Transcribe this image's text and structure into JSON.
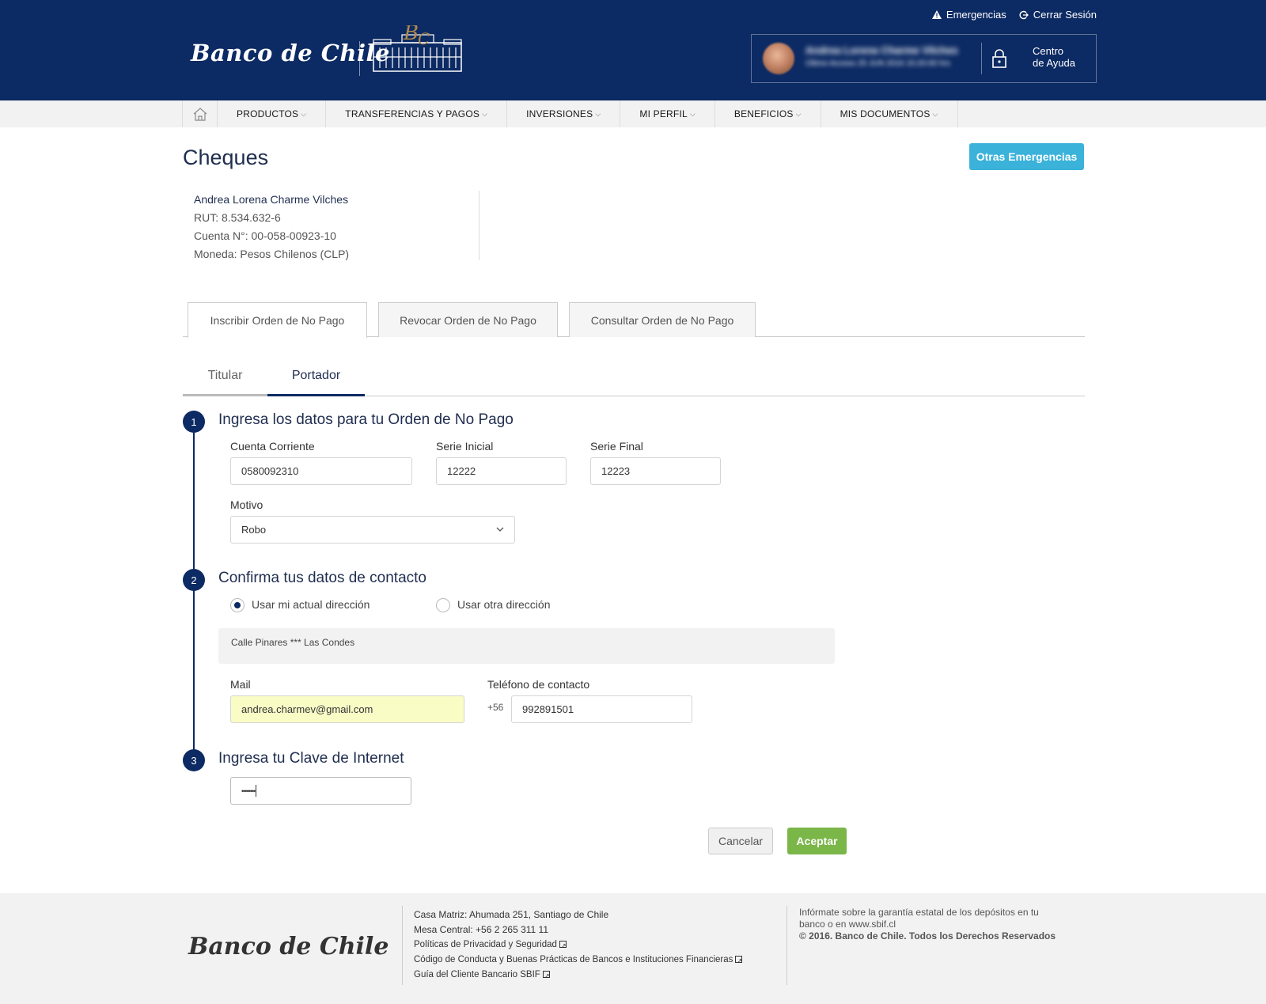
{
  "header": {
    "top_links": {
      "emergencias": "Emergencias",
      "cerrar_sesion": "Cerrar Sesión"
    },
    "logo": "Banco de Chile",
    "user": {
      "name": "Andrea Lorena Charme Vilches",
      "last_access": "Último Acceso 25 JUN 2016 15:20:00 hrs"
    },
    "help": {
      "line1": "Centro",
      "line2": "de Ayuda"
    }
  },
  "nav": {
    "items": [
      "PRODUCTOS",
      "TRANSFERENCIAS Y PAGOS",
      "INVERSIONES",
      "MI PERFIL",
      "BENEFICIOS",
      "MIS DOCUMENTOS"
    ]
  },
  "page": {
    "title": "Cheques",
    "otras_emergencias": "Otras Emergencias"
  },
  "account": {
    "name": "Andrea Lorena Charme Vilches",
    "rut": "RUT: 8.534.632-6",
    "cuenta": "Cuenta N°: 00-058-00923-10",
    "moneda": "Moneda: Pesos Chilenos (CLP)"
  },
  "tabs": [
    "Inscribir Orden de No Pago",
    "Revocar Orden de No Pago",
    "Consultar Orden de No Pago"
  ],
  "subtabs": [
    "Titular",
    "Portador"
  ],
  "step1": {
    "num": "1",
    "title": "Ingresa los datos para tu Orden de No Pago",
    "cuenta_label": "Cuenta Corriente",
    "cuenta_value": "0580092310",
    "serie_inicial_label": "Serie Inicial",
    "serie_inicial_value": "12222",
    "serie_final_label": "Serie Final",
    "serie_final_value": "12223",
    "motivo_label": "Motivo",
    "motivo_value": "Robo"
  },
  "step2": {
    "num": "2",
    "title": "Confirma tus datos de contacto",
    "radio_actual": "Usar mi actual dirección",
    "radio_otra": "Usar otra dirección",
    "address": "Calle Pinares *** Las Condes",
    "mail_label": "Mail",
    "mail_value": "andrea.charmev@gmail.com",
    "telefono_label": "Teléfono de contacto",
    "telefono_prefix": "+56",
    "telefono_value": "992891501"
  },
  "step3": {
    "num": "3",
    "title": "Ingresa tu Clave de Internet",
    "password_value": "••••••••"
  },
  "actions": {
    "cancel": "Cancelar",
    "accept": "Aceptar"
  },
  "footer": {
    "logo": "Banco de Chile",
    "address": "Casa Matriz: Ahumada 251, Santiago de Chile",
    "phone": "Mesa Central: +56 2 265 311 11",
    "link1": "Políticas de Privacidad y Seguridad",
    "link2": "Código de Conducta y Buenas Prácticas de Bancos e Instituciones Financieras",
    "link3": "Guía del Cliente Bancario SBIF",
    "info_line1": "Infórmate sobre la garantía estatal de los depósitos en tu",
    "info_line2": "banco o en www.sbif.cl",
    "copyright": "© 2016. Banco de Chile. Todos los Derechos Reservados"
  },
  "colors": {
    "brand_navy": "#0c2a63",
    "accent_blue": "#3ab2d9",
    "accept_green": "#7ab648",
    "autofill_yellow": "#fafcc6"
  }
}
